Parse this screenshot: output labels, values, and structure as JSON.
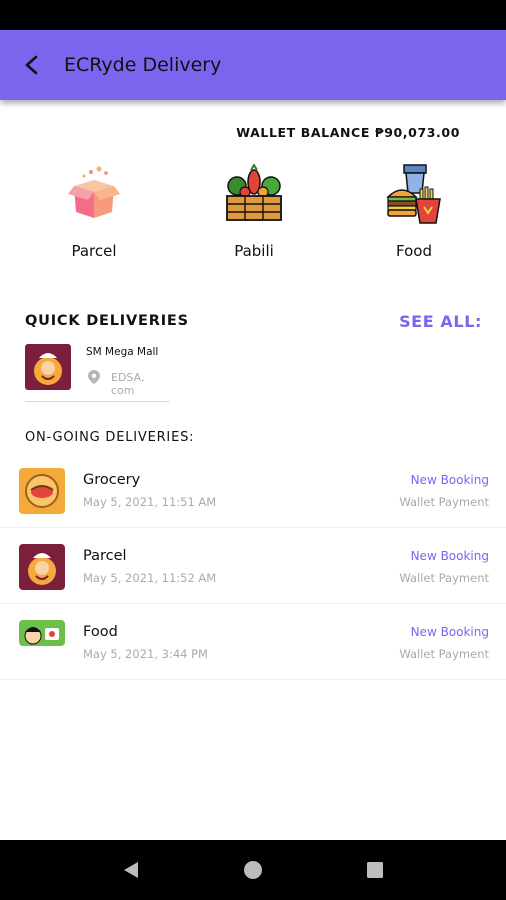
{
  "app_bar": {
    "title": "ECRyde Delivery",
    "back_icon": "arrow-back-icon"
  },
  "wallet": {
    "label": "WALLET BALANCE ₱90,073.00"
  },
  "services": [
    {
      "label": "Parcel",
      "icon": "parcel-box-icon"
    },
    {
      "label": "Pabili",
      "icon": "vegetable-crate-icon"
    },
    {
      "label": "Food",
      "icon": "fast-food-icon"
    }
  ],
  "quick_deliveries": {
    "title": "QUICK DELIVERIES",
    "see_all": "SEE ALL:",
    "items": [
      {
        "name": "SM Mega Mall",
        "address": "EDSA, com",
        "icon": "location-pin-icon"
      }
    ]
  },
  "ongoing": {
    "title": "ON-GOING DELIVERIES:",
    "items": [
      {
        "title": "Grocery",
        "date": "May 5, 2021, 11:51 AM",
        "status": "New Booking",
        "payment": "Wallet Payment"
      },
      {
        "title": "Parcel",
        "date": "May 5, 2021, 11:52 AM",
        "status": "New Booking",
        "payment": "Wallet Payment"
      },
      {
        "title": "Food",
        "date": "May 5, 2021, 3:44 PM",
        "status": "New Booking",
        "payment": "Wallet Payment"
      }
    ]
  },
  "colors": {
    "accent": "#7a66ee",
    "maroon": "#7b1f3a",
    "orange": "#f5a93a",
    "green": "#6cc04a"
  },
  "nav": {
    "back": "nav-back-icon",
    "home": "nav-home-icon",
    "recents": "nav-recents-icon"
  }
}
